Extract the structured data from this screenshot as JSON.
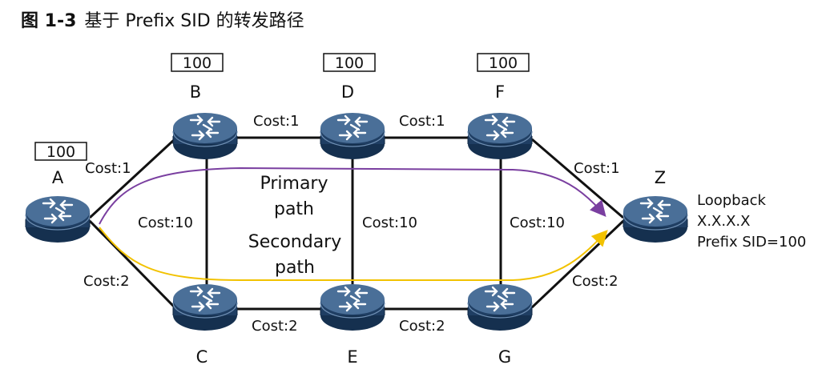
{
  "figure": {
    "number": "图 1-3",
    "caption": "基于 Prefix SID 的转发路径"
  },
  "nodes": [
    {
      "id": "A",
      "label": "A",
      "sid": "100"
    },
    {
      "id": "B",
      "label": "B",
      "sid": "100"
    },
    {
      "id": "D",
      "label": "D",
      "sid": "100"
    },
    {
      "id": "F",
      "label": "F",
      "sid": "100"
    },
    {
      "id": "C",
      "label": "C",
      "sid": ""
    },
    {
      "id": "E",
      "label": "E",
      "sid": ""
    },
    {
      "id": "G",
      "label": "G",
      "sid": ""
    },
    {
      "id": "Z",
      "label": "Z",
      "sid": ""
    }
  ],
  "links": [
    {
      "from": "A",
      "to": "B",
      "cost": "Cost:1"
    },
    {
      "from": "B",
      "to": "D",
      "cost": "Cost:1"
    },
    {
      "from": "D",
      "to": "F",
      "cost": "Cost:1"
    },
    {
      "from": "F",
      "to": "Z",
      "cost": "Cost:1"
    },
    {
      "from": "A",
      "to": "C",
      "cost": "Cost:2"
    },
    {
      "from": "C",
      "to": "E",
      "cost": "Cost:2"
    },
    {
      "from": "E",
      "to": "G",
      "cost": "Cost:2"
    },
    {
      "from": "G",
      "to": "Z",
      "cost": "Cost:2"
    },
    {
      "from": "B",
      "to": "C",
      "cost": "Cost:10"
    },
    {
      "from": "D",
      "to": "E",
      "cost": "Cost:10"
    },
    {
      "from": "F",
      "to": "G",
      "cost": "Cost:10"
    }
  ],
  "loopback": {
    "line1": "Loopback",
    "line2": "X.X.X.X",
    "line3": "Prefix SID=100"
  },
  "paths": {
    "primary": {
      "line1": "Primary",
      "line2": "path",
      "color": "#7a3fa0"
    },
    "secondary": {
      "line1": "Secondary",
      "line2": "path",
      "color": "#f2c200"
    }
  },
  "colors": {
    "router_body": "#1f3e63",
    "router_top": "#4a6f98",
    "link": "#111111"
  }
}
